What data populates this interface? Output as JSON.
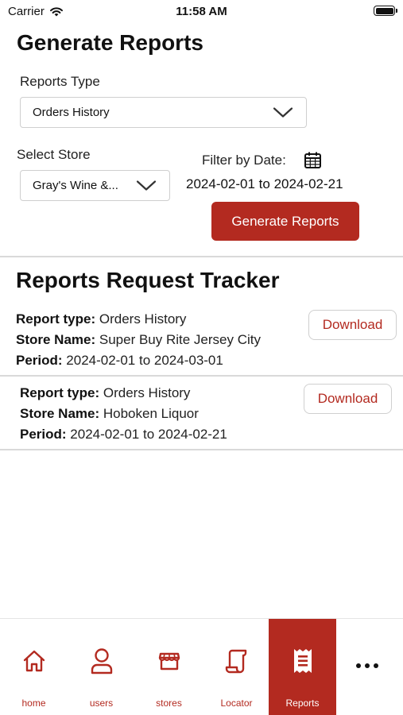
{
  "status_bar": {
    "carrier": "Carrier",
    "time": "11:58 AM"
  },
  "generate": {
    "title": "Generate Reports",
    "reports_type_label": "Reports Type",
    "reports_type_value": "Orders History",
    "select_store_label": "Select Store",
    "select_store_value": "Gray's Wine &...",
    "filter_label": "Filter by Date:",
    "date_range": "2024-02-01 to 2024-02-21",
    "button_label": "Generate Reports"
  },
  "tracker": {
    "title": "Reports Request Tracker",
    "type_key": "Report type:",
    "store_key": "Store Name:",
    "period_key": "Period:",
    "download_label": "Download",
    "items": [
      {
        "type": "Orders History",
        "store": "Super Buy Rite Jersey City",
        "period": "2024-02-01 to 2024-03-01"
      },
      {
        "type": "Orders History",
        "store": "Hoboken Liquor",
        "period": "2024-02-01 to 2024-02-21"
      }
    ]
  },
  "tabs": [
    {
      "label": "home",
      "icon": "home-icon"
    },
    {
      "label": "users",
      "icon": "user-icon"
    },
    {
      "label": "stores",
      "icon": "store-icon"
    },
    {
      "label": "Locator",
      "icon": "scroll-icon"
    },
    {
      "label": "Reports",
      "icon": "receipt-icon",
      "active": true
    }
  ],
  "colors": {
    "accent": "#b32a20",
    "border": "#cfcfcf",
    "separator": "#d9d9d9"
  }
}
